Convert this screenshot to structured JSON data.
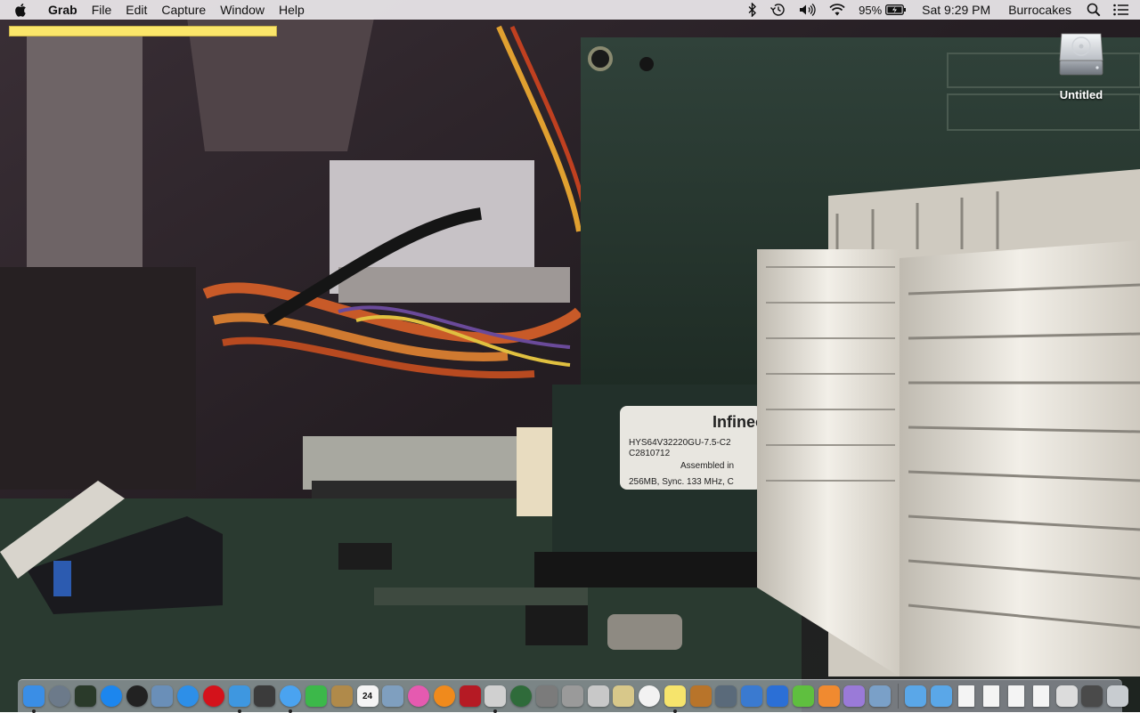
{
  "menubar": {
    "app_name": "Grab",
    "menus": [
      "File",
      "Edit",
      "Capture",
      "Window",
      "Help"
    ],
    "battery_percent": "95%",
    "clock": "Sat 9:29 PM",
    "user": "Burrocakes",
    "status_icons": [
      "bluetooth-icon",
      "time-machine-icon",
      "volume-icon",
      "wifi-icon",
      "battery-charging-icon",
      "spotlight-icon",
      "notification-center-icon"
    ]
  },
  "desktop": {
    "disk_label": "Untitled",
    "wallpaper_labels": [
      "Infineon",
      "HYS64V32220GU-7.5-C2",
      "C2810712",
      "Assembled in",
      "256MB, Sync. 133 MHz, C"
    ]
  },
  "dock": {
    "calendar_day": "24",
    "items": [
      {
        "name": "finder-icon",
        "color": "#3a8ee6",
        "running": true
      },
      {
        "name": "launchpad-icon",
        "color": "#6c7a8a",
        "running": false
      },
      {
        "name": "mission-control-icon",
        "color": "#2a3a2a",
        "running": false
      },
      {
        "name": "app-store-icon",
        "color": "#1c86ee",
        "running": false
      },
      {
        "name": "dashboard-icon",
        "color": "#222222",
        "running": false
      },
      {
        "name": "preview-icon",
        "color": "#6a8fb8",
        "running": false
      },
      {
        "name": "safari-icon",
        "color": "#2d8fe8",
        "running": false
      },
      {
        "name": "opera-icon",
        "color": "#d4121b",
        "running": false
      },
      {
        "name": "airmail-icon",
        "color": "#3e97e0",
        "running": true
      },
      {
        "name": "space-invader-icon",
        "color": "#3b3b3b",
        "running": false
      },
      {
        "name": "messages-icon",
        "color": "#4aa3f0",
        "running": true
      },
      {
        "name": "facetime-icon",
        "color": "#3cb84a",
        "running": false
      },
      {
        "name": "contacts-icon",
        "color": "#b08a4a",
        "running": false
      },
      {
        "name": "calendar-icon",
        "color": "#f4f4f4",
        "running": false
      },
      {
        "name": "photo-browser-icon",
        "color": "#7f9fbf",
        "running": false
      },
      {
        "name": "itunes-icon",
        "color": "#e55ab0",
        "running": false
      },
      {
        "name": "ibooks-icon",
        "color": "#f08a1c",
        "running": false
      },
      {
        "name": "photo-booth-icon",
        "color": "#b51a24",
        "running": false
      },
      {
        "name": "script-editor-icon",
        "color": "#d0d0d0",
        "running": true
      },
      {
        "name": "time-machine-icon",
        "color": "#2f6b3a",
        "running": false
      },
      {
        "name": "system-preferences-icon",
        "color": "#7b7b7b",
        "running": false
      },
      {
        "name": "automator-icon",
        "color": "#9a9a9a",
        "running": false
      },
      {
        "name": "disk-utility-icon",
        "color": "#c8c8c8",
        "running": false
      },
      {
        "name": "image-capture-icon",
        "color": "#d8c88a",
        "running": false
      },
      {
        "name": "photos-icon",
        "color": "#f2f2f2",
        "running": false
      },
      {
        "name": "stickies-icon",
        "color": "#f6e46c",
        "running": true
      },
      {
        "name": "presentation-icon",
        "color": "#b8742a",
        "running": false
      },
      {
        "name": "pen-tool-icon",
        "color": "#5a6a7a",
        "running": false
      },
      {
        "name": "chart-app-icon",
        "color": "#3a7ad0",
        "running": false
      },
      {
        "name": "word-app-icon",
        "color": "#2b6fd6",
        "running": false
      },
      {
        "name": "frog-app-icon",
        "color": "#5fbf3f",
        "running": false
      },
      {
        "name": "horn-app-icon",
        "color": "#f08a30",
        "running": false
      },
      {
        "name": "purple-app-icon",
        "color": "#9a7ad8",
        "running": false
      },
      {
        "name": "archive-app-icon",
        "color": "#7aa0c8",
        "running": false
      },
      {
        "name": "applications-folder-icon",
        "color": "#5aa7e8",
        "running": false
      },
      {
        "name": "documents-folder-icon",
        "color": "#5aa7e8",
        "running": false
      },
      {
        "name": "document-1-icon",
        "color": "#f4f4f4",
        "running": false
      },
      {
        "name": "document-2-icon",
        "color": "#f4f4f4",
        "running": false
      },
      {
        "name": "document-3-icon",
        "color": "#f4f4f4",
        "running": false
      },
      {
        "name": "document-4-icon",
        "color": "#f4f4f4",
        "running": false
      },
      {
        "name": "screen-sharing-icon",
        "color": "#dcdcdc",
        "running": false
      },
      {
        "name": "printer-icon",
        "color": "#4a4a4a",
        "running": false
      },
      {
        "name": "trash-icon",
        "color": "#c8ccd0",
        "running": false
      }
    ]
  }
}
